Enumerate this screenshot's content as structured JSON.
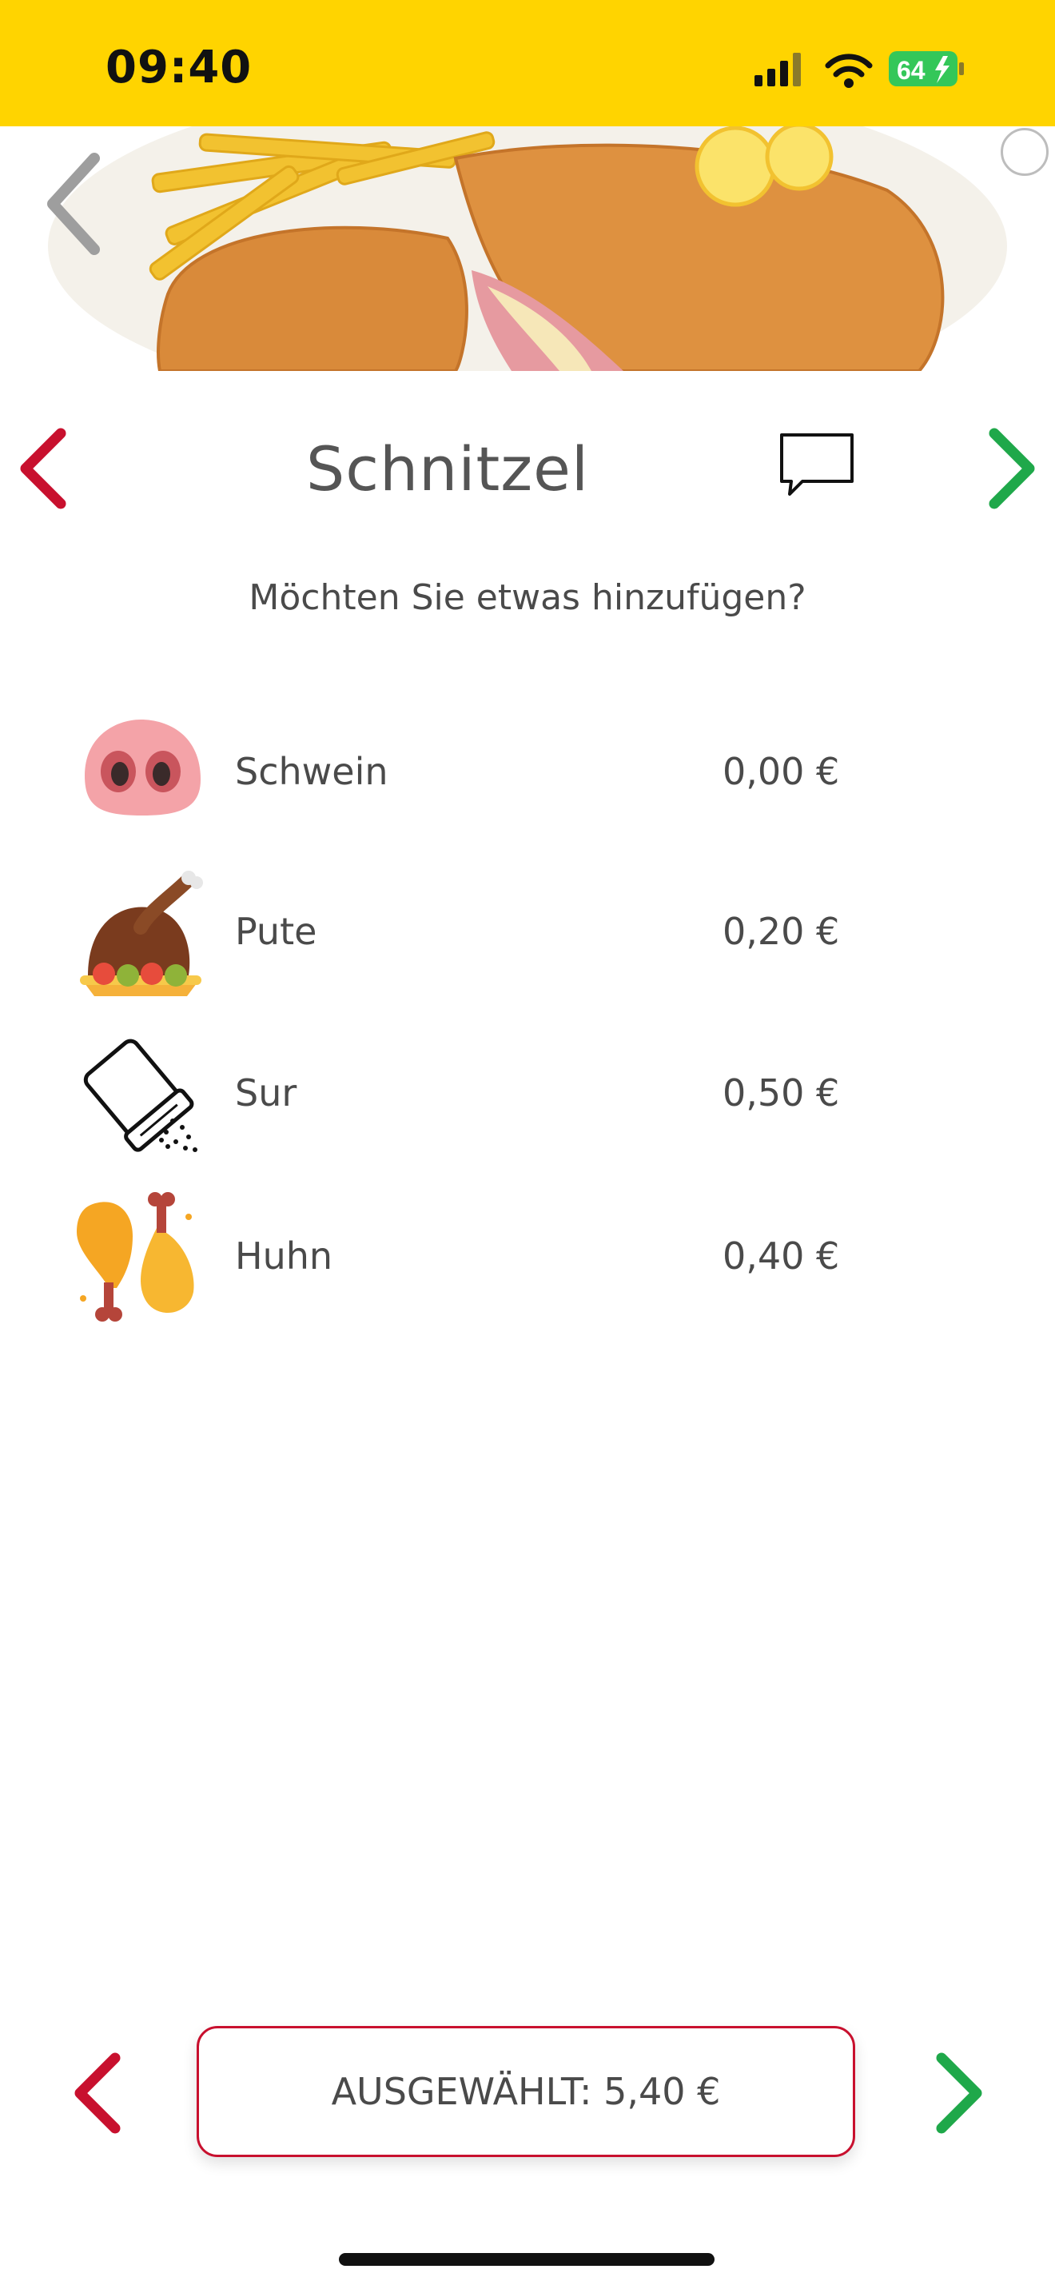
{
  "status_bar": {
    "time": "09:40",
    "battery": "64"
  },
  "product": {
    "title": "Schnitzel",
    "prompt": "Möchten Sie etwas hinzufügen?"
  },
  "options": [
    {
      "name": "Schwein",
      "price": "0,00 €",
      "icon": "pig-snout-icon"
    },
    {
      "name": "Pute",
      "price": "0,20 €",
      "icon": "roast-turkey-icon"
    },
    {
      "name": "Sur",
      "price": "0,50 €",
      "icon": "salt-shaker-icon"
    },
    {
      "name": "Huhn",
      "price": "0,40 €",
      "icon": "chicken-drumstick-icon"
    }
  ],
  "footer": {
    "selected_label": "AUSGEWÄHLT: 5,40 €"
  },
  "colors": {
    "status_bar": "#ffd400",
    "prev_arrow": "#c8102e",
    "next_arrow": "#1fa84a",
    "border": "#c8102e"
  }
}
